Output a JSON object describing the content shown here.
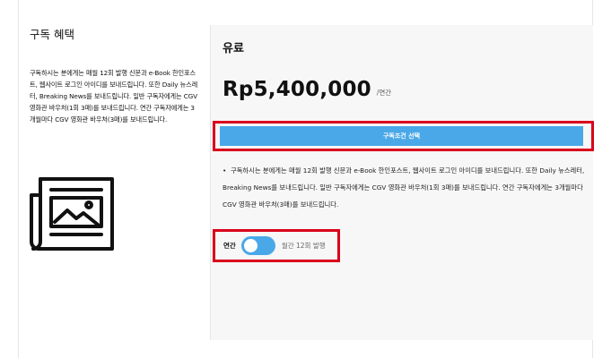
{
  "benefits": {
    "title": "구독 혜택",
    "description": "구독하시는 분에게는 매월 12회 발행 신문과 e-Book 한인포스트, 웹사이트 로그인 아이디를 보내드립니다. 또한 Daily 뉴스레터, Breaking News를 보내드립니다. 일반 구독자에게는 CGV 영화관 바우처(1회 3매)를 보내드립니다. 연간 구독자에게는 3개월마다 CGV 영화관 바우처(3매)를 보내드립니다.",
    "icon": "newspaper-icon"
  },
  "plan": {
    "name": "유료",
    "price": "Rp5,400,000",
    "period": "/연간",
    "cta_label": "구독조건 선택",
    "bullet": "구독하시는 분에게는 매월 12회 발행 신문과 e-Book 한인포스트, 웹사이트 로그인 아이디를 보내드립니다. 또한 Daily 뉴스레터, Breaking News를 보내드립니다. 일반 구독자에게는 CGV 영화관 바우처(1회 3매)를 보내드립니다. 연간 구독자에게는 3개월마다 CGV 영화관 바우처(3매)를 보내드립니다."
  },
  "billing_toggle": {
    "annual_label": "연간",
    "monthly_label": "월간 12회 발행",
    "selected": "annual"
  },
  "colors": {
    "accent": "#4aa8e8",
    "highlight": "#d9001b",
    "panel_bg": "#f7f7f7"
  }
}
